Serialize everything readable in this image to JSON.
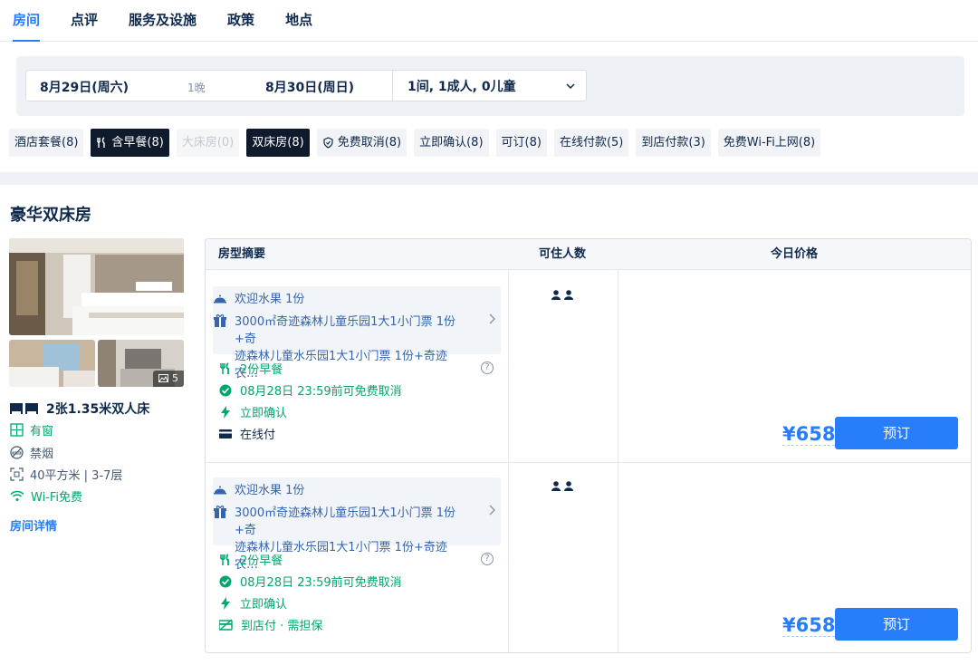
{
  "tabs": [
    "房间",
    "点评",
    "服务及设施",
    "政策",
    "地点"
  ],
  "search": {
    "checkin": "8月29日(周六)",
    "nights": "1晚",
    "checkout": "8月30日(周日)",
    "guests": "1间, 1成人, 0儿童"
  },
  "filters": [
    {
      "label": "酒店套餐(8)",
      "state": "normal"
    },
    {
      "label": "含早餐(8)",
      "state": "active",
      "icon": "utensils-icon"
    },
    {
      "label": "大床房(0)",
      "state": "disabled"
    },
    {
      "label": "双床房(8)",
      "state": "active"
    },
    {
      "label": "免费取消(8)",
      "state": "normal",
      "icon": "shield-check-icon"
    },
    {
      "label": "立即确认(8)",
      "state": "normal"
    },
    {
      "label": "可订(8)",
      "state": "normal"
    },
    {
      "label": "在线付款(5)",
      "state": "normal"
    },
    {
      "label": "到店付款(3)",
      "state": "normal"
    },
    {
      "label": "免费Wi-Fi上网(8)",
      "state": "normal"
    }
  ],
  "room": {
    "title": "豪华双床房",
    "photo_count": "5",
    "bed": "2张1.35米双人床",
    "window": "有窗",
    "smoking": "禁烟",
    "size": "40平方米 | 3-7层",
    "wifi": "Wi-Fi免费",
    "details_link": "房间详情"
  },
  "table": {
    "headers": [
      "房型摘要",
      "可住人数",
      "今日价格"
    ],
    "rows": [
      {
        "gift1": "欢迎水果 1份",
        "gift2_line1": "3000㎡奇迹森林儿童乐园1大1小门票 1份+奇",
        "gift2_line2": "迹森林儿童水乐园1大1小门票 1份+奇迹农…",
        "breakfast": "2份早餐",
        "cancel": "08月28日 23:59前可免费取消",
        "confirm": "立即确认",
        "payment": "在线付",
        "price": "¥658",
        "book": "预订",
        "occupancy": 2
      },
      {
        "gift1": "欢迎水果 1份",
        "gift2_line1": "3000㎡奇迹森林儿童乐园1大1小门票 1份+奇",
        "gift2_line2": "迹森林儿童水乐园1大1小门票 1份+奇迹农…",
        "breakfast": "2份早餐",
        "cancel": "08月28日 23:59前可免费取消",
        "confirm": "立即确认",
        "payment": "到店付 · 需担保",
        "price": "¥658",
        "book": "预订",
        "occupancy": 2
      }
    ]
  },
  "colors": {
    "accent": "#287dfa",
    "green": "#00a66e",
    "dark": "#0f294d"
  }
}
